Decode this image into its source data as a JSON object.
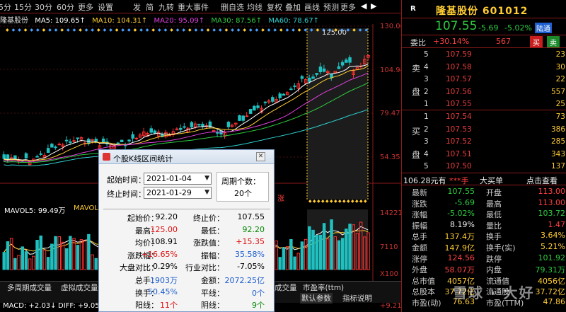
{
  "toolbar": {
    "items": [
      "5分",
      "15分",
      "30分",
      "60分",
      "更多",
      "设置"
    ],
    "right_items": [
      "发",
      "简",
      "九转",
      "重大事件",
      "删自选",
      "均线",
      "复权",
      "叠加",
      "画线",
      "预测"
    ],
    "more": "更多",
    "nav_left": "◀",
    "nav_right": "▶"
  },
  "ma_line": {
    "name": "隆基股份",
    "ma5": "MA5: 109.65↑",
    "ma10": "MA10: 104.31↑",
    "ma20": "MA20: 95.09↑",
    "ma30": "MA30: 87.56↑",
    "ma60": "MA60: 78.67↑"
  },
  "price_axis": [
    "130.06",
    "104.94",
    "79.47",
    "54.35"
  ],
  "high_marker": "125.00",
  "range_mark": "涨",
  "vol_line": {
    "mavol5": "MAVOL5: 99.49万",
    "mavol": "MAVOL"
  },
  "vol_axis": [
    "14221",
    "7110",
    "X100"
  ],
  "macd_line": {
    "macd": "MACD: +2.03↓",
    "diff": "DIFF: +9.05",
    "right": "+9.21"
  },
  "tabs_row1": [
    "多周期成交量",
    "虚拟成交量",
    "成交量",
    "市盈率(ttm)"
  ],
  "tabs_row2": [
    "默认参数",
    "指标说明"
  ],
  "dialog": {
    "title": "个股K线区间统计",
    "start_label": "起始时间：",
    "start_value": "2021-01-04",
    "end_label": "终止时间：",
    "end_value": "2021-01-29",
    "period_label": "周期个数：",
    "period_value": "20个",
    "rows": [
      {
        "a": "起始价：",
        "av": "92.20",
        "avc": "black",
        "b": "终止价：",
        "bv": "107.55",
        "bvc": "black"
      },
      {
        "a": "最高：",
        "av": "125.00",
        "avc": "red",
        "b": "最低：",
        "bv": "92.20",
        "bvc": "green"
      },
      {
        "a": "均价：",
        "av": "108.91",
        "avc": "black",
        "b": "涨跌值：",
        "bv": "+15.35",
        "bvc": "red"
      },
      {
        "a": "涨跌幅：",
        "av": "+16.65%",
        "avc": "red",
        "b": "振幅：",
        "bv": "35.58%",
        "bvc": "blue"
      },
      {
        "a": "大盘对比：",
        "av": "0.29%",
        "avc": "black",
        "b": "行业对比：",
        "bv": "-7.05%",
        "bvc": "black"
      },
      {
        "a": "总手：",
        "av": "1903万",
        "avc": "blue",
        "b": "金额：",
        "bv": "2072.25亿",
        "bvc": "blue"
      },
      {
        "a": "换手：",
        "av": "50.45%",
        "avc": "blue",
        "b": "平线：",
        "bv": "0个",
        "bvc": "blue"
      },
      {
        "a": "阳线：",
        "av": "11个",
        "avc": "red",
        "b": "阴线：",
        "bv": "9个",
        "bvc": "green"
      }
    ]
  },
  "quote": {
    "r": "R",
    "name": "隆基股份 601012",
    "price": "107.55",
    "change": "-5.69",
    "change_pct": "-5.02%",
    "tag": "陆通",
    "weibi_label": "委比",
    "weibi": "+30.14%",
    "weicha": "567",
    "buy": "买",
    "sell": "卖",
    "sell_side": [
      "卖",
      "盘"
    ],
    "buy_side": [
      "买",
      "盘"
    ],
    "asks": [
      {
        "lv": "5",
        "pr": "107.59",
        "qt": "23"
      },
      {
        "lv": "4",
        "pr": "107.58",
        "qt": "30"
      },
      {
        "lv": "3",
        "pr": "107.57",
        "qt": "22"
      },
      {
        "lv": "2",
        "pr": "107.56",
        "qt": "557"
      },
      {
        "lv": "1",
        "pr": "107.55",
        "qt": "25"
      }
    ],
    "bids": [
      {
        "lv": "1",
        "pr": "107.54",
        "qt": "73"
      },
      {
        "lv": "2",
        "pr": "107.53",
        "qt": "386"
      },
      {
        "lv": "3",
        "pr": "107.52",
        "qt": "285"
      },
      {
        "lv": "4",
        "pr": "107.51",
        "qt": "343"
      },
      {
        "lv": "5",
        "pr": "107.50",
        "qt": "137"
      }
    ],
    "big_order": {
      "left": "106.28元有",
      "mid": "***手",
      "big": "大买单",
      "right": "点击查看"
    },
    "stats": [
      {
        "l": "最新",
        "v1": "107.55",
        "c1": "green",
        "l2": "开盘",
        "v2": "113.00",
        "c2": "red"
      },
      {
        "l": "涨跌",
        "v1": "-5.69",
        "c1": "green",
        "l2": "最高",
        "v2": "113.00",
        "c2": "red"
      },
      {
        "l": "涨幅",
        "v1": "-5.02%",
        "c1": "green",
        "l2": "最低",
        "v2": "103.72",
        "c2": "green"
      },
      {
        "l": "振幅",
        "v1": "8.19%",
        "c1": "white",
        "l2": "量比",
        "v2": "1.47",
        "c2": "red"
      },
      {
        "l": "总手",
        "v1": "137.4万",
        "c1": "yel",
        "l2": "换手",
        "v2": "3.64%",
        "c2": "yel"
      },
      {
        "l": "金额",
        "v1": "147.9亿",
        "c1": "yel",
        "l2": "换手(实)",
        "v2": "5.21%",
        "c2": "yel"
      },
      {
        "l": "涨停",
        "v1": "124.56",
        "c1": "red",
        "l2": "跌停",
        "v2": "101.92",
        "c2": "green"
      },
      {
        "l": "外盘",
        "v1": "58.07万",
        "c1": "red",
        "l2": "内盘",
        "v2": "79.31万",
        "c2": "green"
      },
      {
        "l": "总市值",
        "v1": "4057亿",
        "c1": "yel",
        "l2": "流通值",
        "v2": "4056亿",
        "c2": "yel"
      },
      {
        "l": "总股本",
        "v1": "37.72亿",
        "c1": "yel",
        "l2": "流通股",
        "v2": "37.72亿",
        "c2": "yel"
      },
      {
        "l": "市盈(动)",
        "v1": "76.63",
        "c1": "yel",
        "l2": "市盈(TTM)",
        "v2": "47.86",
        "c2": "yel"
      }
    ]
  },
  "watermark": "雪球 ·  大好",
  "colors": {
    "up": "#ff4040",
    "down": "#2ecc40",
    "accent": "#ffcc33",
    "border": "#8a1a1a"
  }
}
